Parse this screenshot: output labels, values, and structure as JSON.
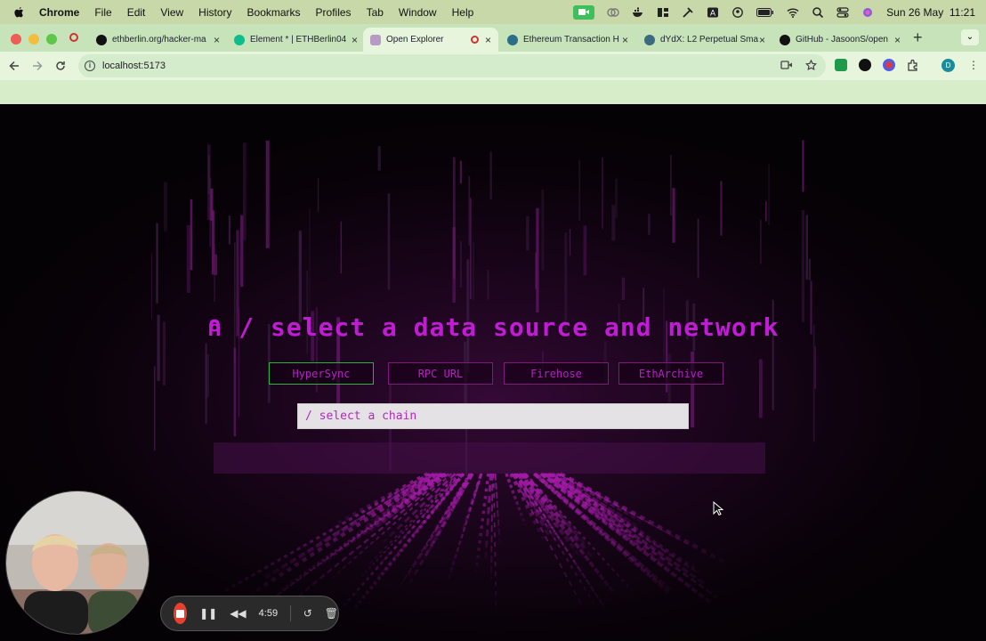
{
  "menubar": {
    "app_name": "Chrome",
    "menus": [
      "File",
      "Edit",
      "View",
      "History",
      "Bookmarks",
      "Profiles",
      "Tab",
      "Window",
      "Help"
    ],
    "datetime": "Sun 26 May  11:21"
  },
  "tabs": [
    {
      "label": "ethberlin.org/hacker-ma",
      "icon": "github-icon",
      "active": false
    },
    {
      "label": "Element * | ETHBerlin04",
      "icon": "element-icon",
      "active": false
    },
    {
      "label": "Open Explorer",
      "icon": "page-icon",
      "active": true
    },
    {
      "label": "Ethereum Transaction H",
      "icon": "globe-icon",
      "active": false
    },
    {
      "label": "dYdX: L2 Perpetual Sma",
      "icon": "globe-icon",
      "active": false
    },
    {
      "label": "GitHub - JasoonS/open",
      "icon": "github-icon",
      "active": false
    }
  ],
  "toolbar": {
    "url": "localhost:5173",
    "profile_initial": "D"
  },
  "page": {
    "headline": "⍝ / select a data source and network",
    "sources": [
      {
        "label": "HyperSync",
        "selected": true
      },
      {
        "label": "RPC URL",
        "selected": false
      },
      {
        "label": "Firehose",
        "selected": false
      },
      {
        "label": "EthArchive",
        "selected": false
      }
    ],
    "chain_placeholder": "/ select a chain"
  },
  "recorder": {
    "elapsed": "4:59"
  },
  "colors": {
    "accent": "#c21bd6",
    "selected_border": "#26b53c",
    "tab_bar": "#c7e3b9"
  }
}
